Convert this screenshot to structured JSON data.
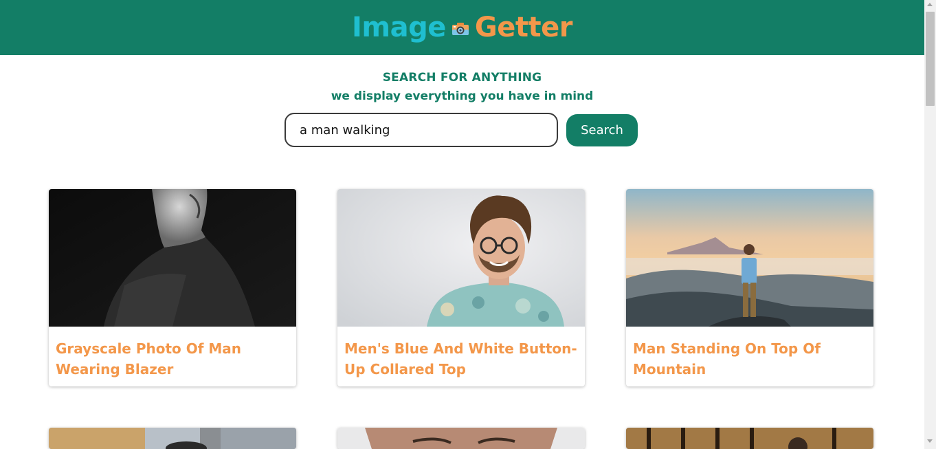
{
  "header": {
    "logo_part1": "Image",
    "logo_icon": "camera-icon",
    "logo_part2": "Getter",
    "bg_color": "#137e66",
    "accent_cyan": "#1fbfd0",
    "accent_orange": "#f3974a"
  },
  "hero": {
    "title": "SEARCH FOR ANYTHING",
    "subtitle": "we display everything you have in mind"
  },
  "search": {
    "value": "a man walking",
    "button_label": "Search"
  },
  "results": [
    {
      "title": "Grayscale Photo Of Man Wearing Blazer"
    },
    {
      "title": "Men's Blue And White Button-Up Collared Top"
    },
    {
      "title": "Man Standing On Top Of Mountain"
    }
  ]
}
